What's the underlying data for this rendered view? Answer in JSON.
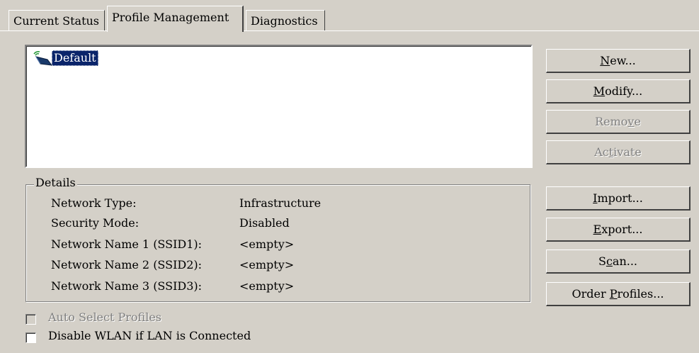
{
  "tabs": [
    {
      "label": "Current Status",
      "active": false
    },
    {
      "label": "Profile Management",
      "active": true
    },
    {
      "label": "Diagnostics",
      "active": false
    }
  ],
  "profiles": [
    {
      "name": "Default",
      "icon": "wireless-profile-icon",
      "selected": true
    }
  ],
  "buttons": {
    "new": {
      "pre": "",
      "key": "N",
      "post": "ew...",
      "enabled": true
    },
    "modify": {
      "pre": "",
      "key": "M",
      "post": "odify...",
      "enabled": true
    },
    "remove": {
      "pre": "Remo",
      "key": "v",
      "post": "e",
      "enabled": false
    },
    "activate": {
      "pre": "Ac",
      "key": "t",
      "post": "ivate",
      "enabled": false
    },
    "import": {
      "pre": "",
      "key": "I",
      "post": "mport...",
      "enabled": true
    },
    "export": {
      "pre": "",
      "key": "E",
      "post": "xport...",
      "enabled": true
    },
    "scan": {
      "pre": "S",
      "key": "c",
      "post": "an...",
      "enabled": true
    },
    "order": {
      "pre": "Order ",
      "key": "P",
      "post": "rofiles...",
      "enabled": true
    }
  },
  "details": {
    "title": "Details",
    "rows": [
      {
        "label": "Network Type:",
        "value": "Infrastructure"
      },
      {
        "label": "Security Mode:",
        "value": "Disabled"
      },
      {
        "label": "Network Name 1 (SSID1):",
        "value": "<empty>"
      },
      {
        "label": "Network Name 2 (SSID2):",
        "value": "<empty>"
      },
      {
        "label": "Network Name 3 (SSID3):",
        "value": "<empty>"
      }
    ]
  },
  "checkboxes": {
    "auto_select": {
      "label": "Auto Select Profiles",
      "checked": false,
      "enabled": false
    },
    "disable_wlan": {
      "label": "Disable WLAN if LAN is Connected",
      "checked": false,
      "enabled": true
    }
  }
}
